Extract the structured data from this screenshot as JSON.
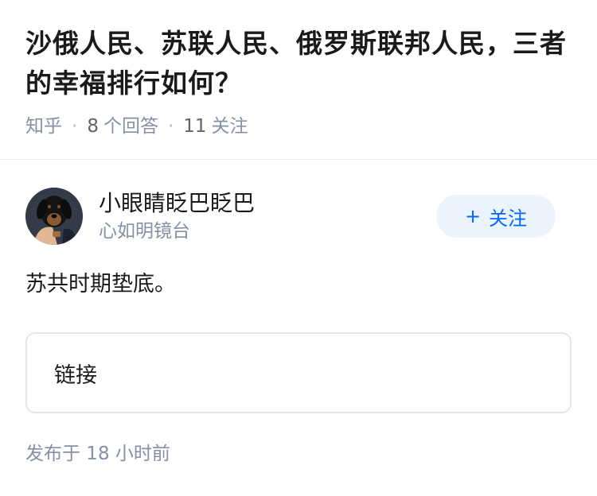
{
  "question": {
    "title": "沙俄人民、苏联人民、俄罗斯联邦人民，三者的幸福排行如何？",
    "source": "知乎",
    "answer_count": "8",
    "answer_label": "个回答",
    "follow_count": "11",
    "follow_label": "关注"
  },
  "answer": {
    "author": {
      "name": "小眼睛眨巴眨巴",
      "bio": "心如明镜台",
      "avatar_icon": "dog-avatar-icon"
    },
    "follow_button": {
      "plus": "+",
      "label": "关注"
    },
    "content": "苏共时期垫底。",
    "link_card": {
      "label": "链接"
    },
    "published": "发布于  18 小时前"
  },
  "colors": {
    "text_primary": "#1a1a1a",
    "text_secondary": "#8590a6",
    "accent_blue": "#0066ff",
    "follow_bg": "#ebf3fd"
  }
}
